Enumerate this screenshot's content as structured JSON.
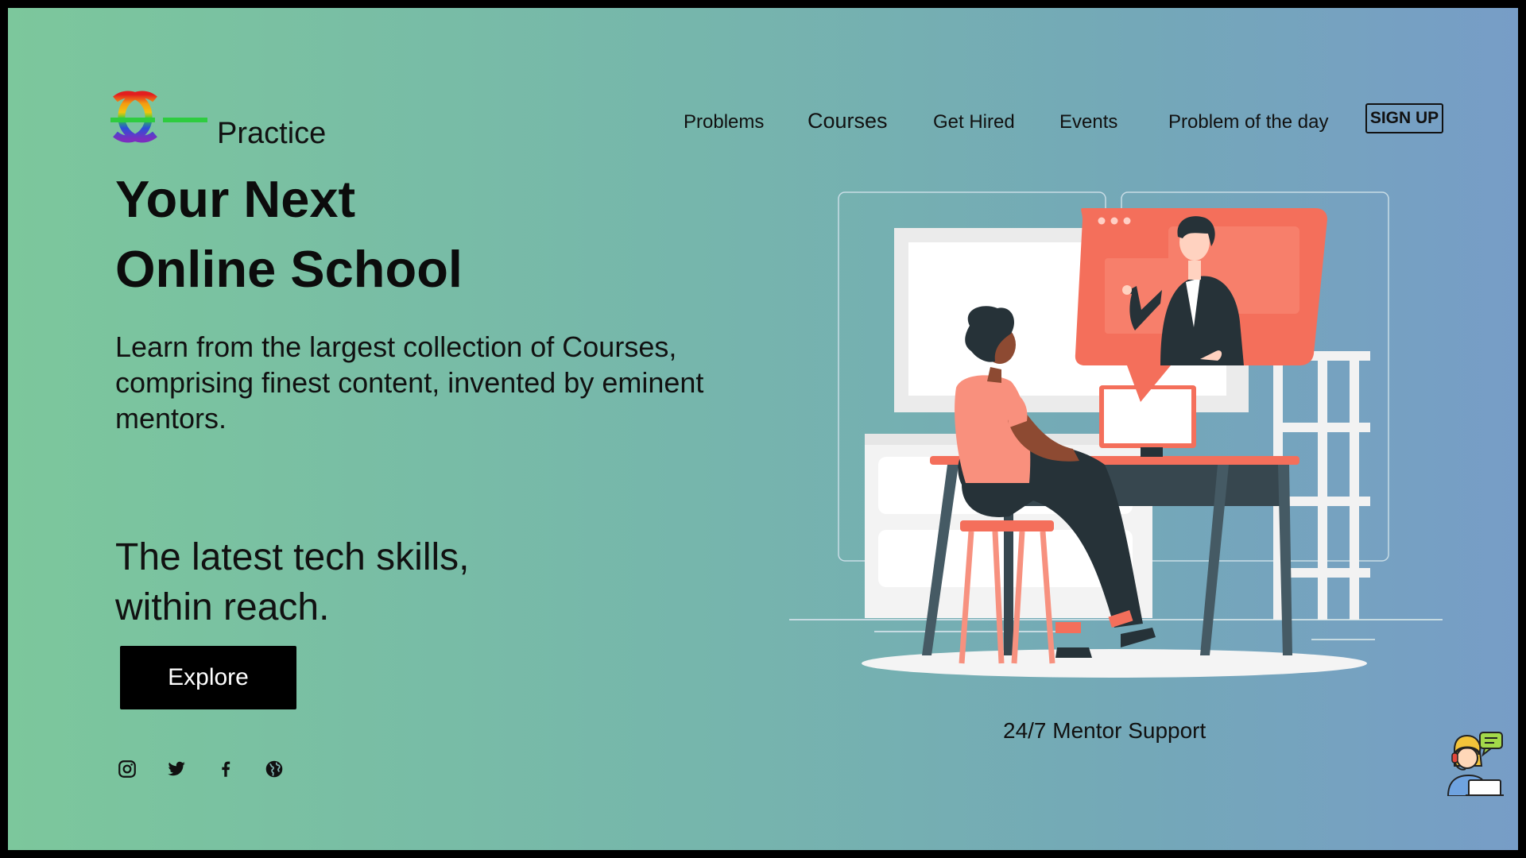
{
  "header": {
    "brand": "Practice",
    "nav": [
      "Problems",
      "Courses",
      "Get Hired",
      "Events",
      "Problem of the day"
    ],
    "signup": "SIGN UP"
  },
  "hero": {
    "title_line1": "Your Next",
    "title_line2": "Online School",
    "subtitle_line1": "Learn from the largest collection of Courses,",
    "subtitle_line2": "comprising finest content, invented by eminent",
    "subtitle_line3": "mentors.",
    "tagline_line1": "The latest tech skills,",
    "tagline_line2": "within reach.",
    "cta": "Explore"
  },
  "social": [
    "instagram-icon",
    "twitter-icon",
    "facebook-icon",
    "globe-icon"
  ],
  "support": {
    "label": "24/7 Mentor Support"
  },
  "colors": {
    "accent": "#f46f5b",
    "dark": "#263238",
    "gradient_start": "#7cc79c",
    "gradient_end": "#779dc7"
  }
}
